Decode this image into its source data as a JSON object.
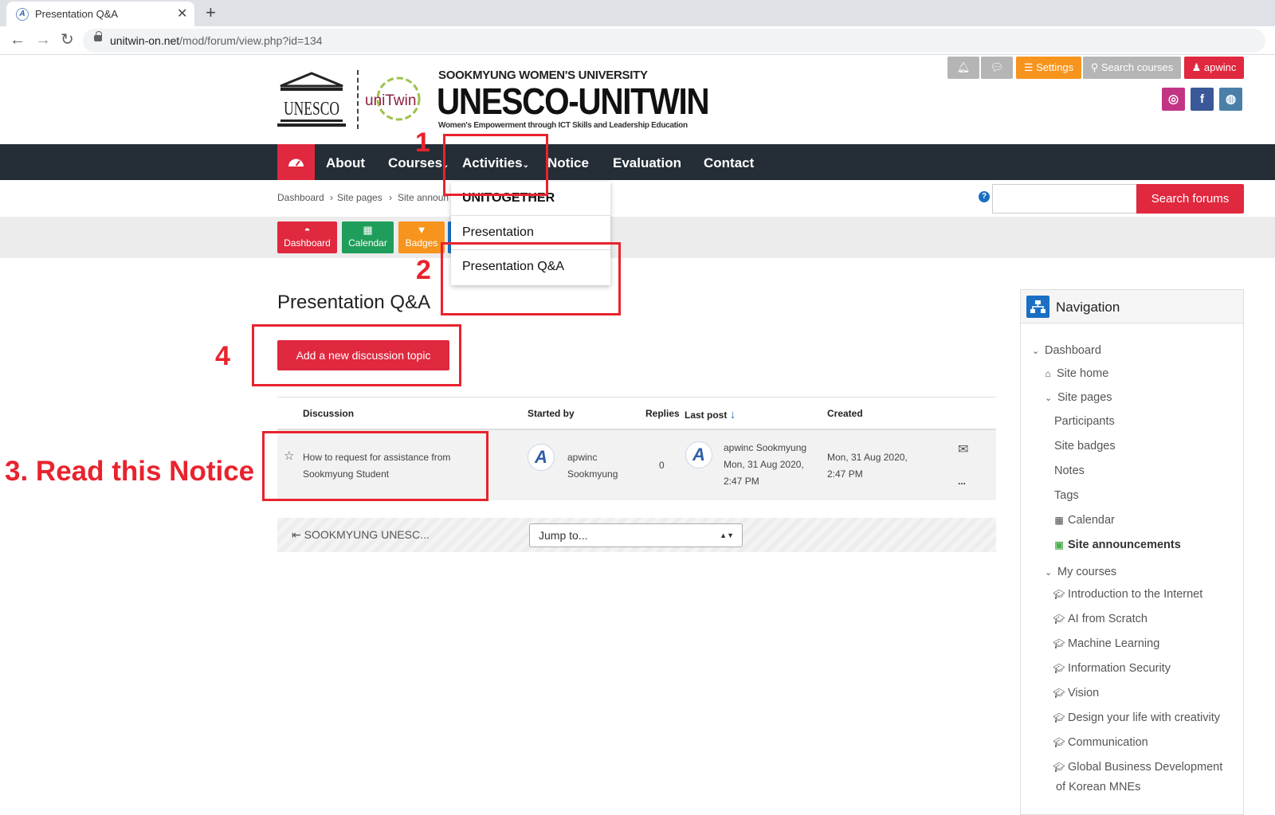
{
  "browser": {
    "tab_title": "Presentation Q&A",
    "url_host": "unitwin-on.net",
    "url_path": "/mod/forum/view.php?id=134"
  },
  "site": {
    "university": "SOOKMYUNG WOMEN'S UNIVERSITY",
    "brand": "UNESCO-UNITWIN",
    "tagline": "Women's Empowerment through ICT Skills and Leadership Education",
    "unesco_text": "UNESCO",
    "unitwin_text": "uniTwin"
  },
  "topbar": {
    "settings": "Settings",
    "search_courses": "Search courses",
    "user": "apwinc"
  },
  "nav": {
    "items": [
      "About",
      "Courses",
      "Activities",
      "Notice",
      "Evaluation",
      "Contact"
    ]
  },
  "dropdown": {
    "items": [
      "UNITOGETHER",
      "Presentation",
      "Presentation Q&A"
    ]
  },
  "breadcrumb": [
    "Dashboard",
    "Site pages",
    "Site announ"
  ],
  "search": {
    "button": "Search forums"
  },
  "quicklinks": [
    "Dashboard",
    "Calendar",
    "Badges"
  ],
  "main": {
    "title": "Presentation Q&A",
    "add_button": "Add a new discussion topic",
    "columns": [
      "Discussion",
      "Started by",
      "Replies",
      "Last post",
      "Created"
    ],
    "row": {
      "discussion_line1": "How to request for assistance from",
      "discussion_line2": "Sookmyung Student",
      "starter_line1": "apwinc",
      "starter_line2": "Sookmyung",
      "replies": "0",
      "last_by": "apwinc Sookmyung",
      "last_date": "Mon, 31 Aug 2020,",
      "last_time": "2:47 PM",
      "created_date": "Mon, 31 Aug 2020,",
      "created_time": "2:47 PM",
      "more": "..."
    },
    "prev_link": "SOOKMYUNG UNESC...",
    "jump": "Jump to..."
  },
  "sidebar": {
    "title": "Navigation",
    "dashboard": "Dashboard",
    "site_home": "Site home",
    "site_pages": "Site pages",
    "pages": [
      "Participants",
      "Site badges",
      "Notes",
      "Tags",
      "Calendar",
      "Site announcements"
    ],
    "my_courses": "My courses",
    "courses": [
      "Introduction to the Internet",
      "AI from Scratch",
      "Machine Learning",
      "Information Security",
      "Vision",
      "Design your life with creativity",
      "Communication",
      "Global Business Development",
      "of Korean MNEs"
    ]
  },
  "annotations": {
    "a1": "1",
    "a2": "2",
    "a3": "3. Read this Notice",
    "a4": "4"
  },
  "colors": {
    "accent_red": "#e0283f",
    "navbar": "#252d36",
    "annotation_red": "#e8232e"
  }
}
